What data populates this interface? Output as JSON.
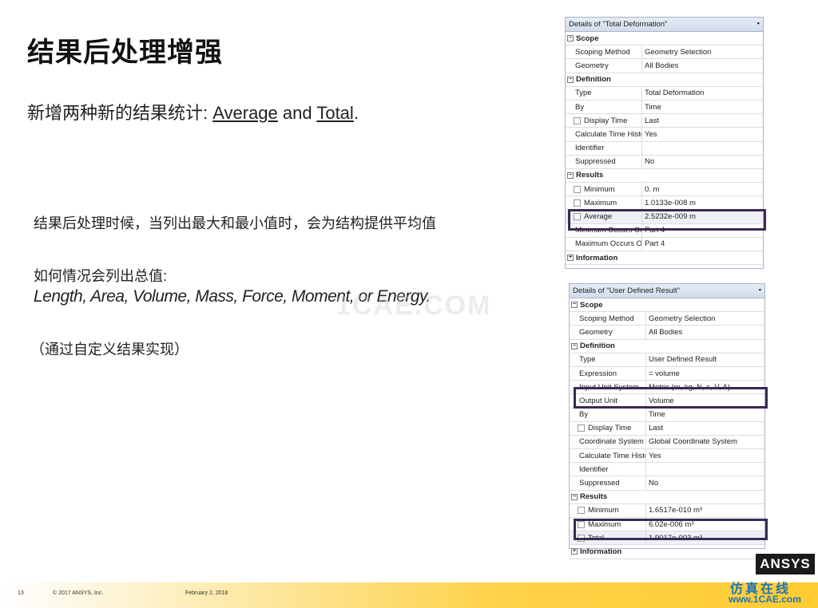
{
  "slide": {
    "title": "结果后处理增强",
    "subtitle_prefix": "新增两种新的结果统计: ",
    "subtitle_avg": "Average",
    "subtitle_and": " and ",
    "subtitle_total": "Total",
    "subtitle_suffix": ".",
    "line1": "结果后处理时候，当列出最大和最小值时，会为结构提供平均值",
    "line2": "如何情况会列出总值:",
    "line3": "Length, Area, Volume, Mass, Force, Moment, or Energy.",
    "line4": "（通过自定义结果实现）",
    "watermark": "1CAE.COM"
  },
  "panel1": {
    "title": "Details of \"Total Deformation\"",
    "pin": "▪",
    "scope": "Scope",
    "scoping_method_label": "Scoping Method",
    "scoping_method_value": "Geometry Selection",
    "geometry_label": "Geometry",
    "geometry_value": "All Bodies",
    "definition": "Definition",
    "type_label": "Type",
    "type_value": "Total Deformation",
    "by_label": "By",
    "by_value": "Time",
    "display_time_label": "Display Time",
    "display_time_value": "Last",
    "calc_label": "Calculate Time History",
    "calc_value": "Yes",
    "identifier_label": "Identifier",
    "identifier_value": "",
    "suppressed_label": "Suppressed",
    "suppressed_value": "No",
    "results": "Results",
    "minimum_label": "Minimum",
    "minimum_value": "0. m",
    "maximum_label": "Maximum",
    "maximum_value": "1.0133e-008 m",
    "average_label": "Average",
    "average_value": "2.5232e-009 m",
    "min_occurs_label": "Minimum Occurs On",
    "min_occurs_value": "Part 4",
    "max_occurs_label": "Maximum Occurs On",
    "max_occurs_value": "Part 4",
    "information": "Information"
  },
  "panel2": {
    "title": "Details of \"User Defined Result\"",
    "pin": "▪",
    "scope": "Scope",
    "scoping_method_label": "Scoping Method",
    "scoping_method_value": "Geometry Selection",
    "geometry_label": "Geometry",
    "geometry_value": "All Bodies",
    "definition": "Definition",
    "type_label": "Type",
    "type_value": "User Defined Result",
    "expression_label": "Expression",
    "expression_value": "= volume",
    "input_unit_label": "Input Unit System",
    "input_unit_value": "Metric (m, kg, N, s, V, A)",
    "output_unit_label": "Output Unit",
    "output_unit_value": "Volume",
    "by_label": "By",
    "by_value": "Time",
    "display_time_label": "Display Time",
    "display_time_value": "Last",
    "coord_label": "Coordinate System",
    "coord_value": "Global Coordinate System",
    "calc_label": "Calculate Time History",
    "calc_value": "Yes",
    "identifier_label": "Identifier",
    "identifier_value": "",
    "suppressed_label": "Suppressed",
    "suppressed_value": "No",
    "results": "Results",
    "minimum_label": "Minimum",
    "minimum_value": "1.6517e-010 m³",
    "maximum_label": "Maximum",
    "maximum_value": "6.02e-006 m³",
    "total_label": "Total",
    "total_value": "1.9017e-003 m³",
    "information": "Information"
  },
  "footer": {
    "page": "13",
    "copyright": "© 2017 ANSYS, Inc.",
    "date": "February 2, 2018",
    "logo": "ANSYS",
    "brand_cn": "仿真在线",
    "brand_url": "www.1CAE.com"
  }
}
